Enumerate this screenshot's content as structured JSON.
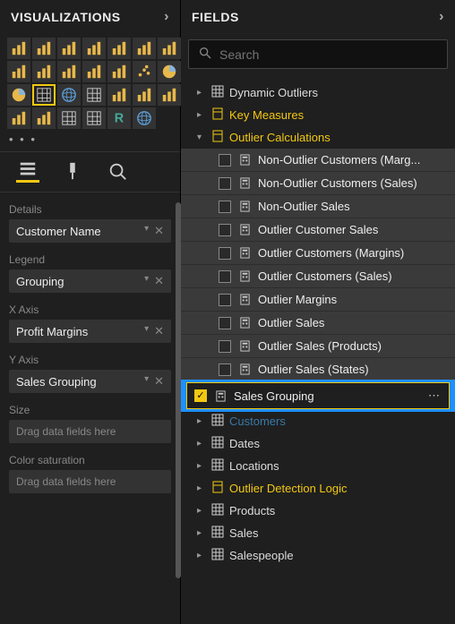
{
  "viz": {
    "header": "VISUALIZATIONS",
    "more": "• • •",
    "tiles": [
      "stacked-bar",
      "clustered-bar",
      "stacked-col",
      "clustered-col",
      "line",
      "area",
      "stacked-area",
      "line-col",
      "line-stacked",
      "ribbon",
      "waterfall",
      "funnel",
      "scatter",
      "pie",
      "donut",
      "treemap",
      "map",
      "filled-map",
      "gauge",
      "card",
      "multicard",
      "kpi",
      "slicer",
      "table",
      "matrix",
      "r-visual",
      "arcgis"
    ],
    "selected_tile_index": 15,
    "tabs": [
      "fields",
      "format",
      "analytics"
    ],
    "wells": [
      {
        "label": "Details",
        "field": "Customer Name"
      },
      {
        "label": "Legend",
        "field": "Grouping"
      },
      {
        "label": "X Axis",
        "field": "Profit Margins"
      },
      {
        "label": "Y Axis",
        "field": "Sales Grouping"
      },
      {
        "label": "Size",
        "placeholder": "Drag data fields here"
      },
      {
        "label": "Color saturation",
        "placeholder": "Drag data fields here"
      }
    ]
  },
  "fields": {
    "header": "FIELDS",
    "search_placeholder": "Search",
    "tables": [
      {
        "name": "Dynamic Outliers",
        "expanded": false,
        "key": false
      },
      {
        "name": "Key Measures",
        "expanded": false,
        "key": true
      },
      {
        "name": "Outlier Calculations",
        "expanded": true,
        "key": true,
        "items": [
          {
            "label": "Non-Outlier Customers (Marg...",
            "checked": false
          },
          {
            "label": "Non-Outlier Customers (Sales)",
            "checked": false
          },
          {
            "label": "Non-Outlier Sales",
            "checked": false
          },
          {
            "label": "Outlier Customer Sales",
            "checked": false
          },
          {
            "label": "Outlier Customers (Margins)",
            "checked": false
          },
          {
            "label": "Outlier Customers (Sales)",
            "checked": false
          },
          {
            "label": "Outlier Margins",
            "checked": false
          },
          {
            "label": "Outlier Sales",
            "checked": false
          },
          {
            "label": "Outlier Sales (Products)",
            "checked": false
          },
          {
            "label": "Outlier Sales (States)",
            "checked": false
          },
          {
            "label": "Sales Grouping",
            "checked": true,
            "highlight": true
          }
        ]
      },
      {
        "name": "Customers",
        "expanded": false,
        "key": false,
        "dim": true
      },
      {
        "name": "Dates",
        "expanded": false,
        "key": false
      },
      {
        "name": "Locations",
        "expanded": false,
        "key": false
      },
      {
        "name": "Outlier Detection Logic",
        "expanded": false,
        "key": true
      },
      {
        "name": "Products",
        "expanded": false,
        "key": false
      },
      {
        "name": "Sales",
        "expanded": false,
        "key": false
      },
      {
        "name": "Salespeople",
        "expanded": false,
        "key": false
      }
    ]
  }
}
